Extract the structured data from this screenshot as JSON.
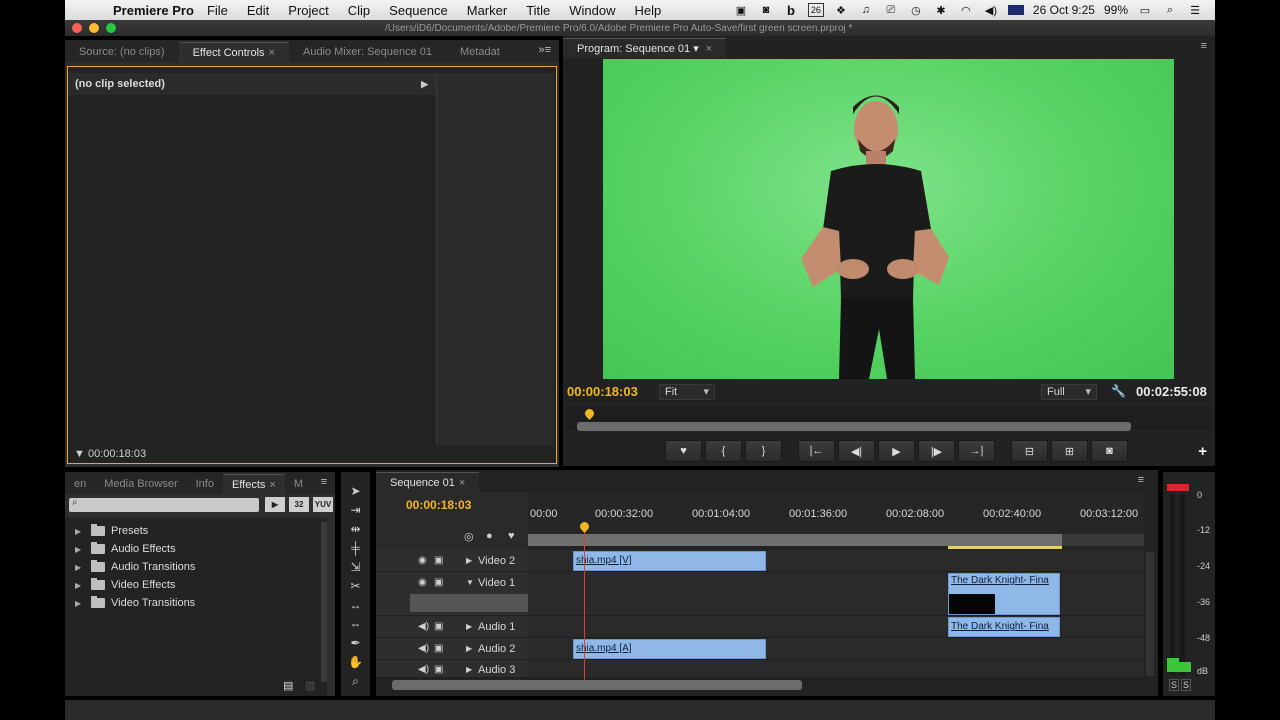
{
  "menubar": {
    "apple": "",
    "app_name": "Premiere Pro",
    "menus": [
      "File",
      "Edit",
      "Project",
      "Clip",
      "Sequence",
      "Marker",
      "Title",
      "Window",
      "Help"
    ],
    "calendar_day": "26",
    "date_time": "26 Oct  9:25",
    "battery": "99%"
  },
  "window": {
    "path": "/Users/iD6/Documents/Adobe/Premiere Pro/6.0/Adobe Premiere Pro Auto-Save/first green screen.prproj *"
  },
  "effect_controls": {
    "tabs": [
      "Source: (no clips)",
      "Effect Controls",
      "Audio Mixer: Sequence 01",
      "Metadat"
    ],
    "header": "(no clip selected)",
    "timecode": "00:00:18:03"
  },
  "program": {
    "tab": "Program: Sequence 01",
    "current_time": "00:00:18:03",
    "duration": "00:02:55:08",
    "fit": "Fit",
    "resolution": "Full"
  },
  "effects_panel": {
    "tabs": [
      "en",
      "Media Browser",
      "Info",
      "Effects",
      "M"
    ],
    "buttons": [
      "32",
      "YUV"
    ],
    "items": [
      "Presets",
      "Audio Effects",
      "Audio Transitions",
      "Video Effects",
      "Video Transitions"
    ]
  },
  "timeline": {
    "tab": "Sequence 01",
    "current_time": "00:00:18:03",
    "ruler": [
      "00:00",
      "00:00:32:00",
      "00:01:04:00",
      "00:01:36:00",
      "00:02:08:00",
      "00:02:40:00",
      "00:03:12:00"
    ],
    "tracks": [
      "Video 2",
      "Video 1",
      "Audio 1",
      "Audio 2",
      "Audio 3"
    ],
    "clips": {
      "video2": "shia.mp4 [V]",
      "video1": "The Dark Knight- Fina",
      "audio1": "The Dark Knight- Fina",
      "audio2": "shia.mp4 [A]"
    }
  },
  "meters": {
    "labels": [
      "0",
      "-12",
      "-24",
      "-36",
      "-48",
      "dB"
    ],
    "solo": [
      "S",
      "S"
    ]
  }
}
